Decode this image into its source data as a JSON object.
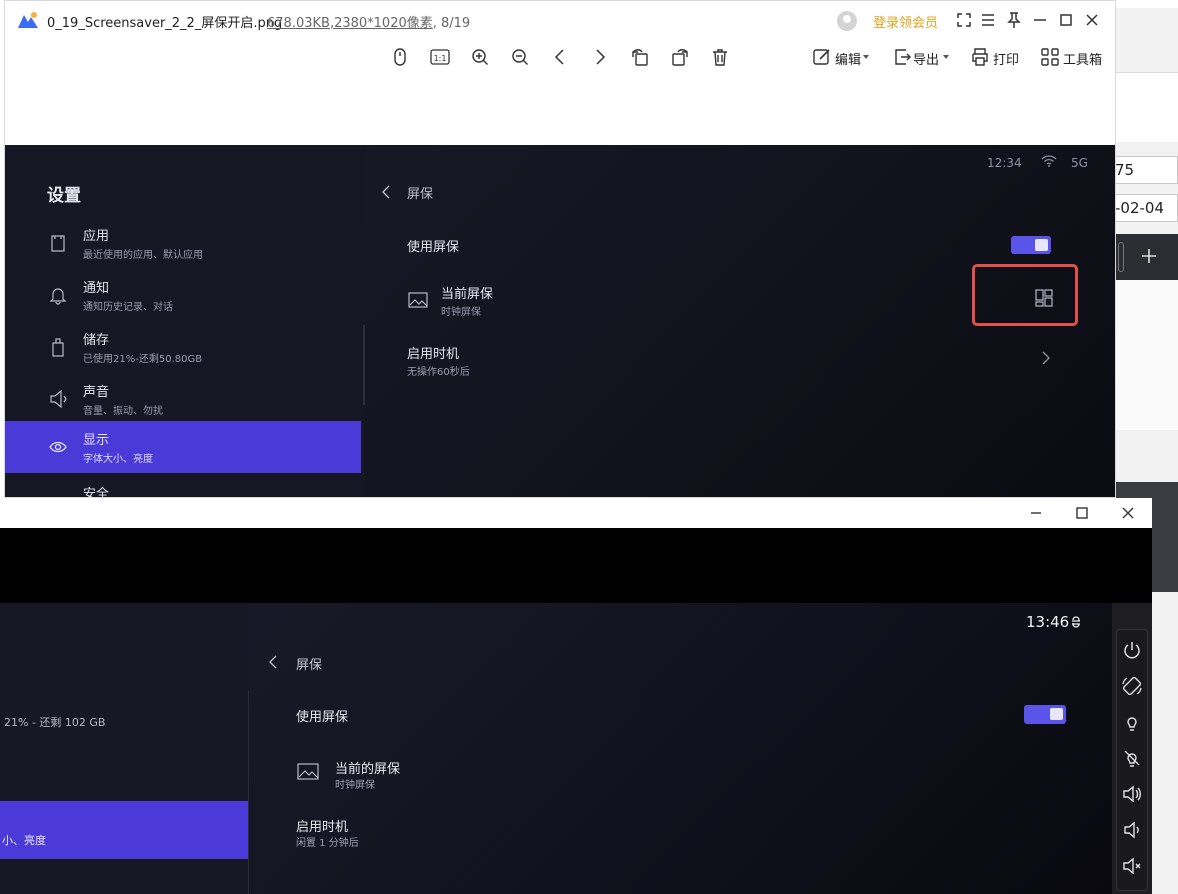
{
  "background": {
    "field_1": "75",
    "field_2": "-02-04"
  },
  "viewer": {
    "filename": "0_19_Screensaver_2_2_屏保开启.png",
    "filesize": "678.03KB",
    "dimensions": ",2380*1020像素",
    "position": ", 8/19",
    "vip_link": "登录领会员",
    "toolbar": {
      "edit_label": "编辑",
      "export_label": "导出",
      "print_label": "打印",
      "toolbox_label": "工具箱"
    },
    "screenshot": {
      "time": "12:34",
      "network": "5G",
      "settings_title": "设置",
      "menu": [
        {
          "label": "应用",
          "sub": "最近使用的应用、默认应用",
          "icon": "app-bag-icon"
        },
        {
          "label": "通知",
          "sub": "通知历史记录、对话",
          "icon": "bell-icon"
        },
        {
          "label": "储存",
          "sub": "已使用21%-还剩50.80GB",
          "icon": "storage-icon"
        },
        {
          "label": "声音",
          "sub": "音量、振动、勿扰",
          "icon": "speaker-icon"
        },
        {
          "label": "显示",
          "sub": "字体大小、亮度",
          "icon": "eye-icon"
        },
        {
          "label": "安全",
          "sub": "",
          "icon": "security-icon"
        }
      ],
      "header": "屏保",
      "use_screensaver": "使用屏保",
      "current_screensaver": "当前屏保",
      "current_screensaver_value": "时钟屏保",
      "start_timing": "启用时机",
      "start_timing_value": "无操作60秒后"
    }
  },
  "emulator": {
    "time": "13:46",
    "header": "屏保",
    "storage_sub": "21% - 还剩 102 GB",
    "display_sub": "小、亮度",
    "use_screensaver": "使用屏保",
    "current_screensaver": "当前的屏保",
    "current_screensaver_value": "时钟屏保",
    "start_timing": "启用时机",
    "start_timing_value": "闲置 1 分钟后",
    "side_tools": [
      "power-icon",
      "rotate-icon",
      "brightness-up-icon",
      "brightness-off-icon",
      "volume-up-icon",
      "volume-down-icon",
      "mute-icon"
    ]
  },
  "colors": {
    "accent": "#4a3ad8",
    "highlight": "#e1504a",
    "vip": "#e3a21a"
  }
}
